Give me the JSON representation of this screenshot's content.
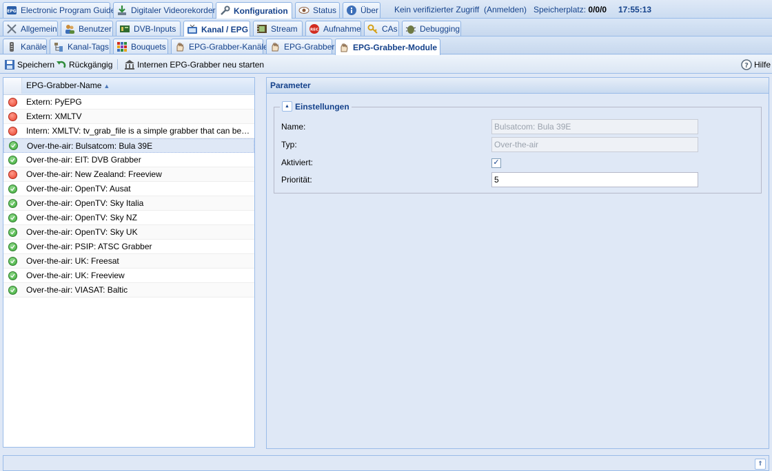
{
  "nav_top": {
    "tabs": [
      {
        "label": "Electronic Program Guide",
        "icon": "epg-icon"
      },
      {
        "label": "Digitaler Videorekorder",
        "icon": "download-icon"
      },
      {
        "label": "Konfiguration",
        "icon": "wrench-icon",
        "active": true
      },
      {
        "label": "Status",
        "icon": "eye-icon"
      },
      {
        "label": "Über",
        "icon": "info-icon"
      }
    ],
    "access_status": "Kein verifizierter Zugriff",
    "login_link": "(Anmelden)",
    "storage_label": "Speicherplatz:",
    "storage_value": "0/0/0",
    "time": "17:55:13"
  },
  "nav_config": {
    "tabs": [
      {
        "label": "Allgemein",
        "icon": "tools-icon"
      },
      {
        "label": "Benutzer",
        "icon": "users-icon"
      },
      {
        "label": "DVB-Inputs",
        "icon": "card-icon"
      },
      {
        "label": "Kanal / EPG",
        "icon": "tv-icon",
        "active": true
      },
      {
        "label": "Stream",
        "icon": "film-icon"
      },
      {
        "label": "Aufnahme",
        "icon": "rec-icon"
      },
      {
        "label": "CAs",
        "icon": "key-icon"
      },
      {
        "label": "Debugging",
        "icon": "bug-icon"
      }
    ]
  },
  "nav_channel": {
    "tabs": [
      {
        "label": "Kanäle",
        "icon": "remote-icon"
      },
      {
        "label": "Kanal-Tags",
        "icon": "tags-icon"
      },
      {
        "label": "Bouquets",
        "icon": "grid-icon"
      },
      {
        "label": "EPG-Grabber-Kanäle",
        "icon": "grabber-icon"
      },
      {
        "label": "EPG-Grabber",
        "icon": "grabber-icon"
      },
      {
        "label": "EPG-Grabber-Module",
        "icon": "grabber-icon",
        "active": true
      }
    ]
  },
  "toolbar": {
    "save_label": "Speichern",
    "undo_label": "Rückgängig",
    "restart_label": "Internen EPG-Grabber neu starten",
    "help_label": "Hilfe"
  },
  "grid": {
    "column_header": "EPG-Grabber-Name",
    "rows": [
      {
        "name": "Extern: PyEPG",
        "enabled": false
      },
      {
        "name": "Extern: XMLTV",
        "enabled": false
      },
      {
        "name": "Intern: XMLTV: tv_grab_file is a simple grabber that can be confi…",
        "enabled": false
      },
      {
        "name": "Over-the-air: Bulsatcom: Bula 39E",
        "enabled": true,
        "selected": true
      },
      {
        "name": "Over-the-air: EIT: DVB Grabber",
        "enabled": true
      },
      {
        "name": "Over-the-air: New Zealand: Freeview",
        "enabled": false
      },
      {
        "name": "Over-the-air: OpenTV: Ausat",
        "enabled": true
      },
      {
        "name": "Over-the-air: OpenTV: Sky Italia",
        "enabled": true
      },
      {
        "name": "Over-the-air: OpenTV: Sky NZ",
        "enabled": true
      },
      {
        "name": "Over-the-air: OpenTV: Sky UK",
        "enabled": true
      },
      {
        "name": "Over-the-air: PSIP: ATSC Grabber",
        "enabled": true
      },
      {
        "name": "Over-the-air: UK: Freesat",
        "enabled": true
      },
      {
        "name": "Over-the-air: UK: Freeview",
        "enabled": true
      },
      {
        "name": "Over-the-air: VIASAT: Baltic",
        "enabled": true
      }
    ]
  },
  "params": {
    "title": "Parameter",
    "fieldset_title": "Einstellungen",
    "name_label": "Name:",
    "name_value": "Bulsatcom: Bula 39E",
    "type_label": "Typ:",
    "type_value": "Over-the-air",
    "enabled_label": "Aktiviert:",
    "enabled_value": true,
    "priority_label": "Priorität:",
    "priority_value": "5"
  },
  "colors": {
    "enabled_dot": "#3fae3a",
    "disabled_dot": "#e8412c",
    "accent": "#15428b"
  }
}
